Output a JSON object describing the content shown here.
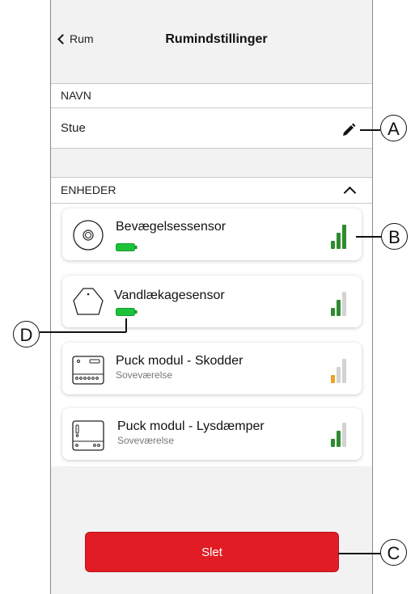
{
  "header": {
    "back_label": "Rum",
    "title": "Rumindstillinger"
  },
  "name_section": {
    "heading": "NAVN",
    "value": "Stue"
  },
  "devices_section": {
    "heading": "ENHEDER"
  },
  "devices": [
    {
      "name": "Bevægelsessensor",
      "subtitle": "",
      "icon": "motion-sensor-icon",
      "battery": "full",
      "signal_level": 3,
      "signal_color": "#2e8b2e"
    },
    {
      "name": "Vandlækagesensor",
      "subtitle": "",
      "icon": "water-leak-sensor-icon",
      "battery": "full",
      "signal_level": 2,
      "signal_color": "#2e8b2e"
    },
    {
      "name": "Puck modul - Skodder",
      "subtitle": "Soveværelse",
      "icon": "puck-module-icon",
      "battery": "none",
      "signal_level": 1,
      "signal_color": "#f0a020"
    },
    {
      "name": "Puck modul - Lysdæmper",
      "subtitle": "Soveværelse",
      "icon": "puck-dimmer-icon",
      "battery": "none",
      "signal_level": 2,
      "signal_color": "#2e8b2e"
    }
  ],
  "delete_button": {
    "label": "Slet"
  },
  "callouts": {
    "a": "A",
    "b": "B",
    "c": "C",
    "d": "D"
  },
  "colors": {
    "accent_red": "#e21c25",
    "signal_green": "#2e8b2e",
    "signal_orange": "#f0a020",
    "battery_green": "#1ec23a"
  }
}
